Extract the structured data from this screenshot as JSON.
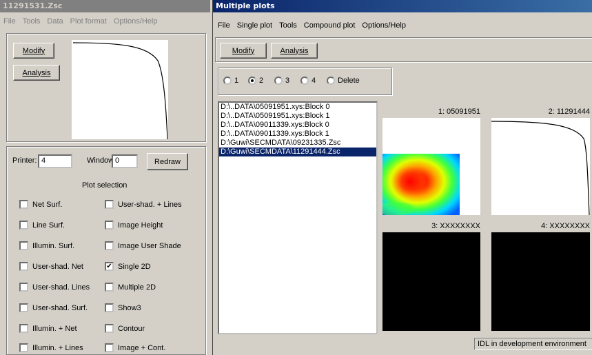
{
  "left_window": {
    "title": "11291531.Zsc",
    "menu": [
      "File",
      "Tools",
      "Data",
      "Plot format",
      "Options/Help"
    ],
    "modify_label": "Modify",
    "analysis_label": "Analysis",
    "printer_label": "Printer:",
    "printer_value": "4",
    "window_label": "Window:",
    "window_value": "0",
    "redraw_label": "Redraw",
    "plot_selection_label": "Plot selection",
    "checkboxes": [
      {
        "label": "Net Surf.",
        "checked": false
      },
      {
        "label": "User-shad. + Lines",
        "checked": false
      },
      {
        "label": "Line Surf.",
        "checked": false
      },
      {
        "label": "Image Height",
        "checked": false
      },
      {
        "label": "Illumin. Surf.",
        "checked": false
      },
      {
        "label": "Image User Shade",
        "checked": false
      },
      {
        "label": "User-shad. Net",
        "checked": false
      },
      {
        "label": "Single 2D",
        "checked": true
      },
      {
        "label": "User-shad. Lines",
        "checked": false
      },
      {
        "label": "Multiple 2D",
        "checked": false
      },
      {
        "label": "User-shad. Surf.",
        "checked": false
      },
      {
        "label": "Show3",
        "checked": false
      },
      {
        "label": "Illumin. + Net",
        "checked": false
      },
      {
        "label": "Contour",
        "checked": false
      },
      {
        "label": "Illumin. + Lines",
        "checked": false
      },
      {
        "label": "Image + Cont.",
        "checked": false
      }
    ]
  },
  "right_window": {
    "title": "Multiple plots",
    "menu": [
      "File",
      "Single plot",
      "Tools",
      "Compound plot",
      "Options/Help"
    ],
    "modify_label": "Modify",
    "analysis_label": "Analysis",
    "radios": [
      {
        "label": "1",
        "selected": false
      },
      {
        "label": "2",
        "selected": true
      },
      {
        "label": "3",
        "selected": false
      },
      {
        "label": "4",
        "selected": false
      },
      {
        "label": "Delete",
        "selected": false
      }
    ],
    "files": [
      "D:\\..DATA\\05091951.xys:Block 0",
      "D:\\..DATA\\05091951.xys:Block 1",
      "D:\\..DATA\\09011339.xys:Block 0",
      "D:\\..DATA\\09011339.xys:Block 1",
      "D:\\Guwi\\SECMDATA\\09231335.Zsc",
      "D:\\Guwi\\SECMDATA\\11291444.Zsc"
    ],
    "selected_file_index": 5,
    "plots": [
      {
        "label": "1: 05091951"
      },
      {
        "label": "2: 11291444"
      },
      {
        "label": "3: XXXXXXXX"
      },
      {
        "label": "4: XXXXXXXX"
      }
    ],
    "status": "IDL in development environment"
  }
}
